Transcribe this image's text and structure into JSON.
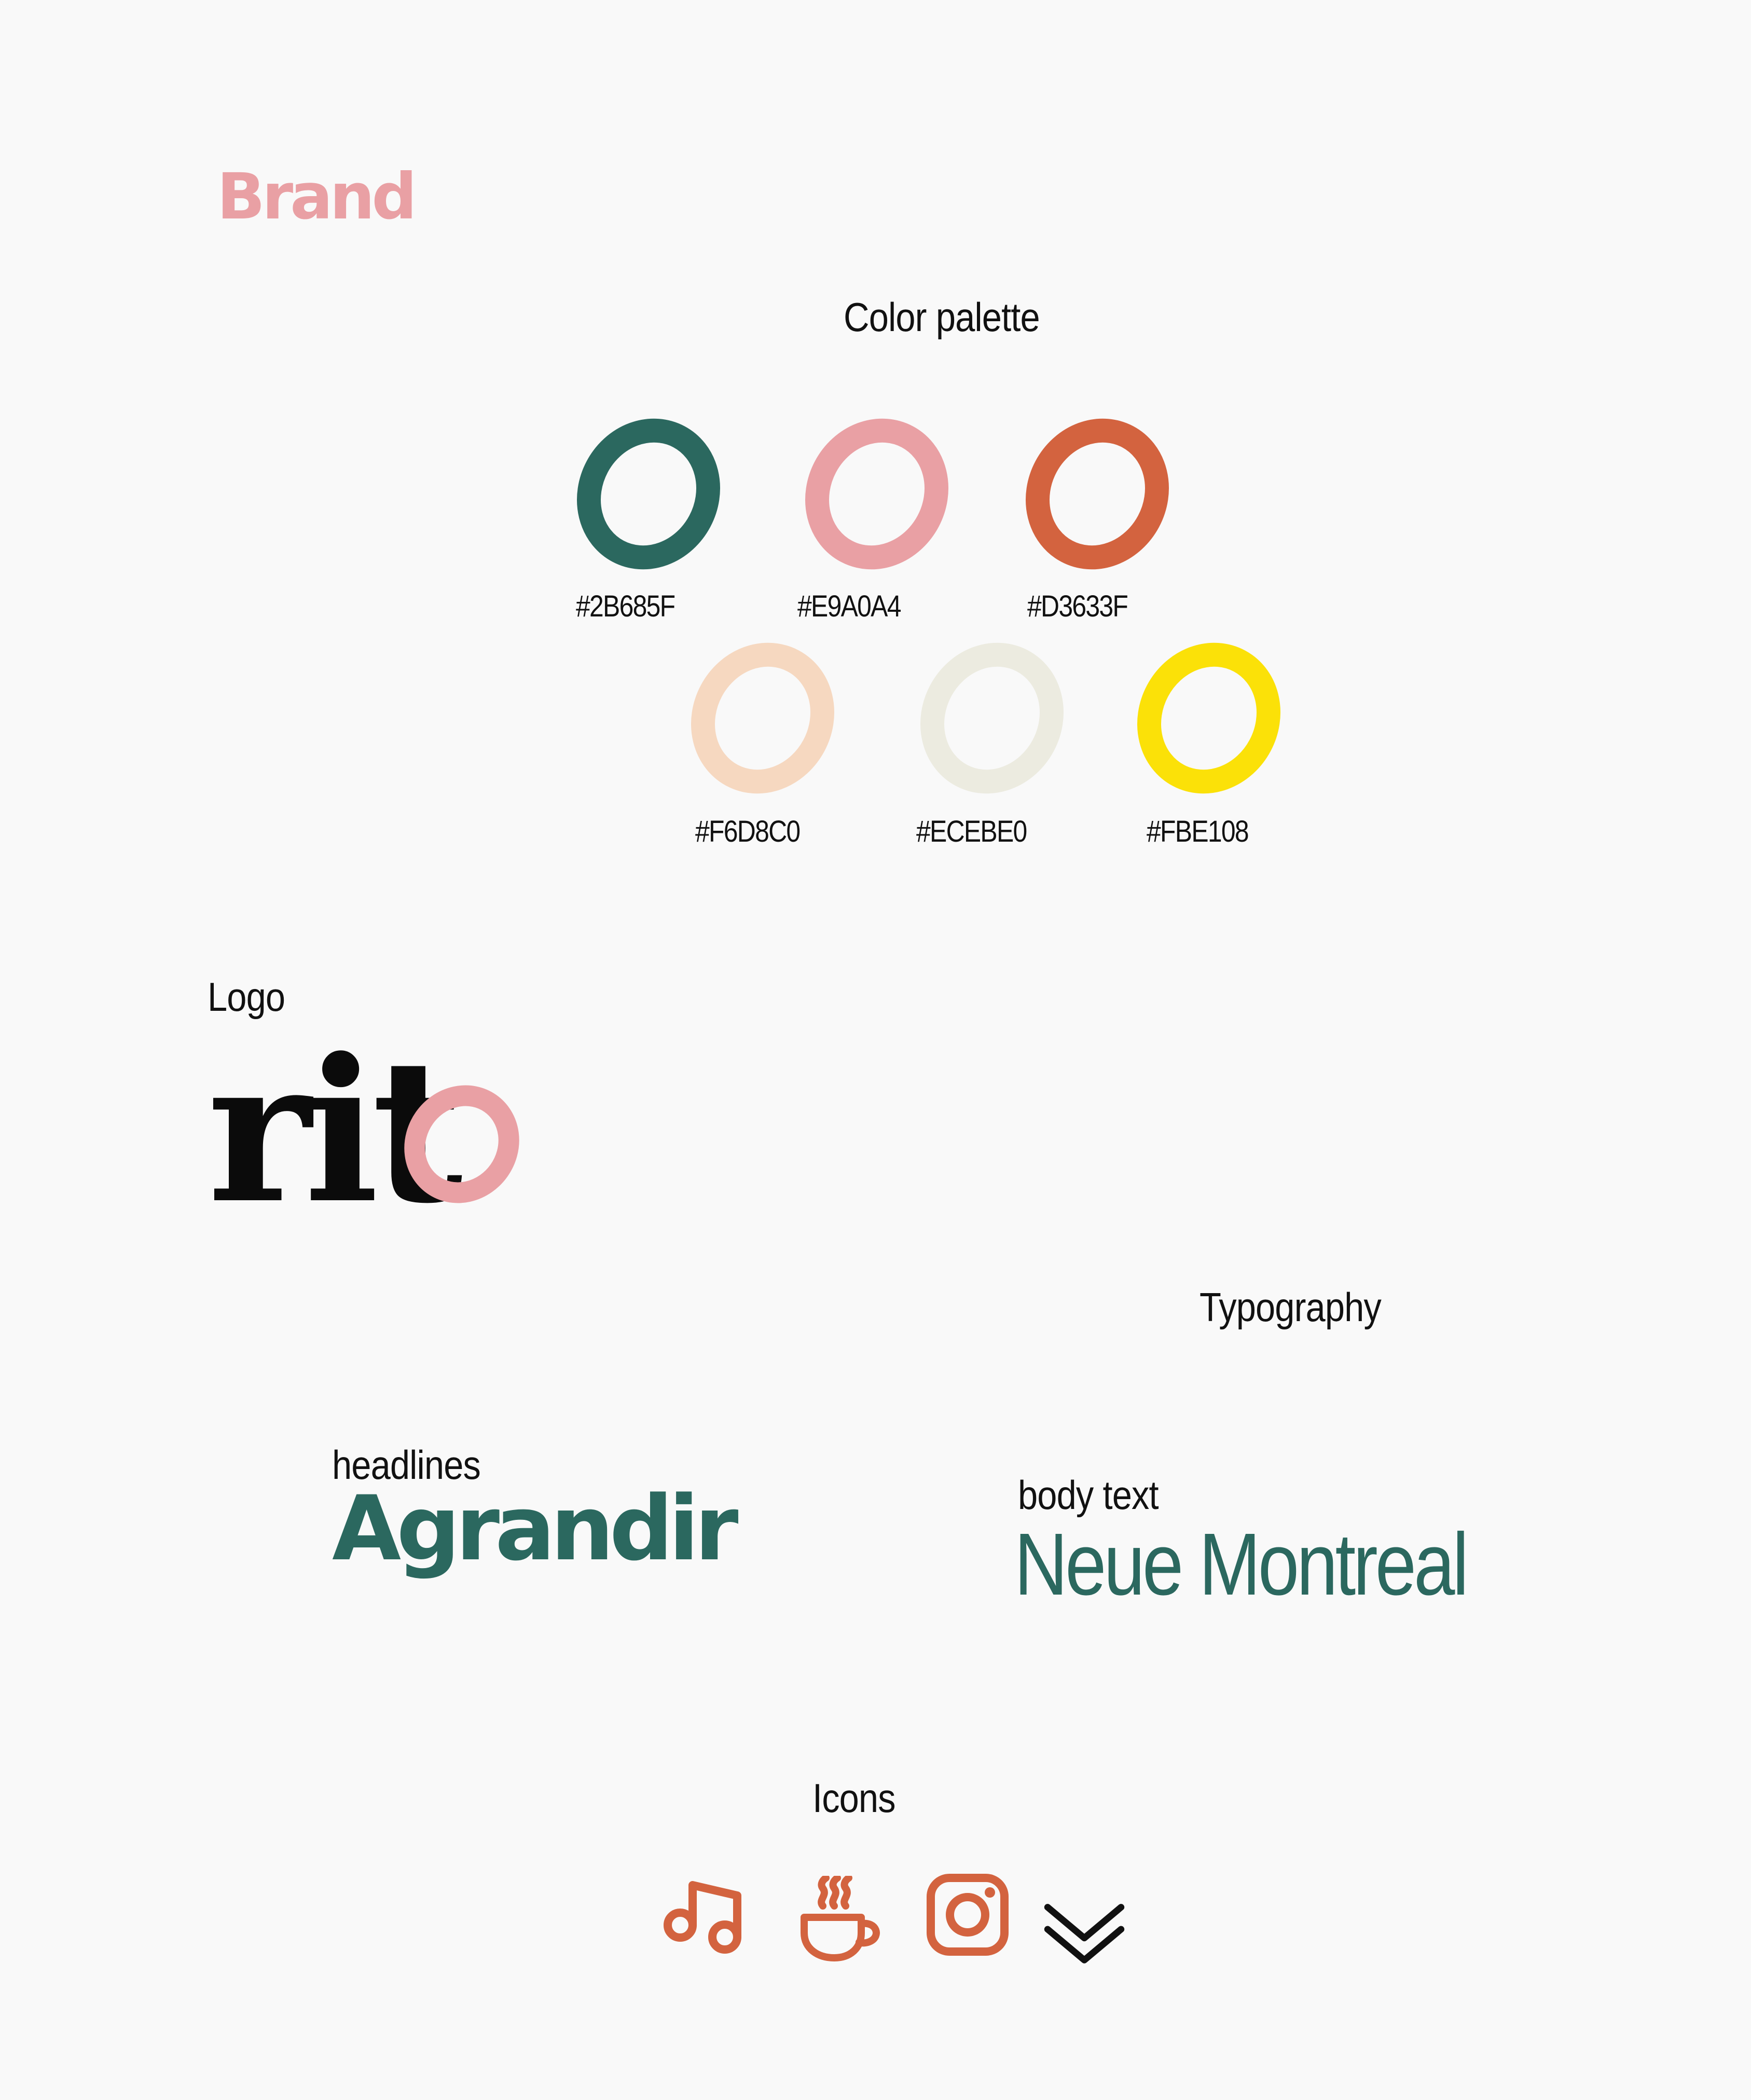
{
  "brand": {
    "title": "Brand",
    "title_color": "#E9A0A4"
  },
  "palette": {
    "heading": "Color palette",
    "colors": [
      {
        "hex": "#2B685F",
        "label": "#2B685F"
      },
      {
        "hex": "#E9A0A4",
        "label": "#E9A0A4"
      },
      {
        "hex": "#D3633F",
        "label": "#D3633F"
      },
      {
        "hex": "#F6D8C0",
        "label": "#F6D8C0"
      },
      {
        "hex": "#ECEBE0",
        "label": "#ECEBE0"
      },
      {
        "hex": "#FBE108",
        "label": "#FBE108"
      }
    ]
  },
  "logo": {
    "heading": "Logo",
    "text": "rit",
    "ring_color": "#E9A0A4"
  },
  "typography": {
    "heading": "Typography",
    "headlines": {
      "label": "headlines",
      "font_name": "Agrandir"
    },
    "body": {
      "label": "body text",
      "font_name": "Neue Montreal"
    },
    "font_color": "#2B685F"
  },
  "icons": {
    "heading": "Icons",
    "accent_color": "#D3633F",
    "items": [
      "music-note-icon",
      "coffee-cup-icon",
      "instagram-icon",
      "double-chevron-down-icon"
    ]
  }
}
